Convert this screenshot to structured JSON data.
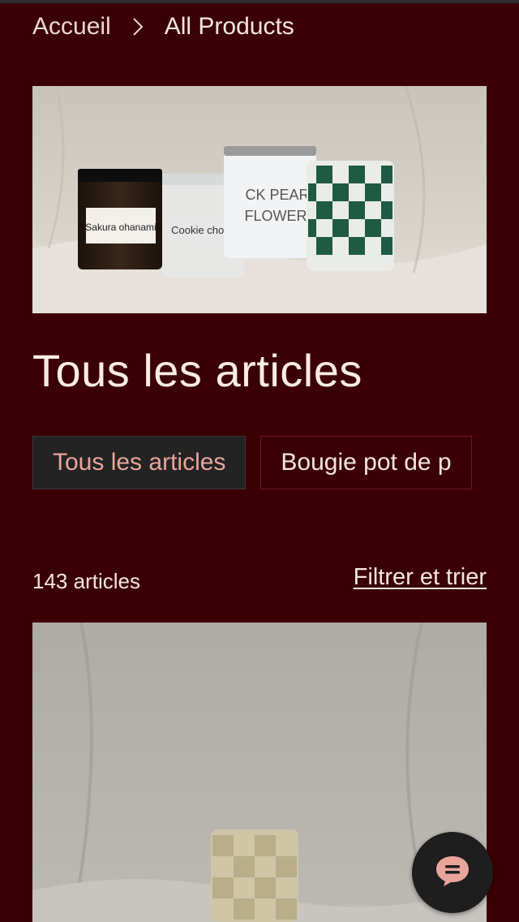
{
  "breadcrumb": {
    "home": "Accueil",
    "current": "All Products"
  },
  "hero": {
    "products": [
      {
        "label": "Sakura ohanami"
      },
      {
        "label": "Cookie chocol"
      },
      {
        "label": "CK PEAR\nFLOWER"
      }
    ]
  },
  "page_title": "Tous les articles",
  "tabs": [
    {
      "label": "Tous les articles",
      "active": true
    },
    {
      "label": "Bougie pot de p",
      "active": false
    }
  ],
  "listing": {
    "count_text": "143 articles",
    "filter_label": "Filtrer et trier"
  },
  "icons": {
    "chevron": "chevron-right-icon",
    "chat": "chat-bubble-icon"
  },
  "colors": {
    "background": "#3b0003",
    "text": "#f3e6dd",
    "active_tab_bg": "#232323",
    "active_tab_text": "#e9a59c",
    "chat_icon": "#e9a59c"
  }
}
